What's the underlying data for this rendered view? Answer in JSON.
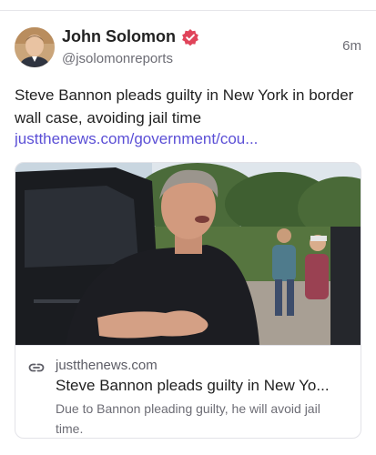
{
  "post": {
    "author_name": "John Solomon",
    "handle": "@jsolomonreports",
    "timestamp": "6m",
    "text": "Steve Bannon pleads guilty in New York in border wall case, avoiding jail time",
    "link_text": "justthenews.com/government/cou..."
  },
  "link_card": {
    "domain": "justthenews.com",
    "title": "Steve Bannon pleads guilty in New Yo...",
    "description": "Due to Bannon pleading guilty, he will avoid jail time."
  },
  "icons": {
    "verified": "verified-badge-icon",
    "link": "link-icon"
  },
  "colors": {
    "accent": "#5b4fd6",
    "verified_badge": "#e0445a",
    "muted_text": "#6d6d75"
  }
}
